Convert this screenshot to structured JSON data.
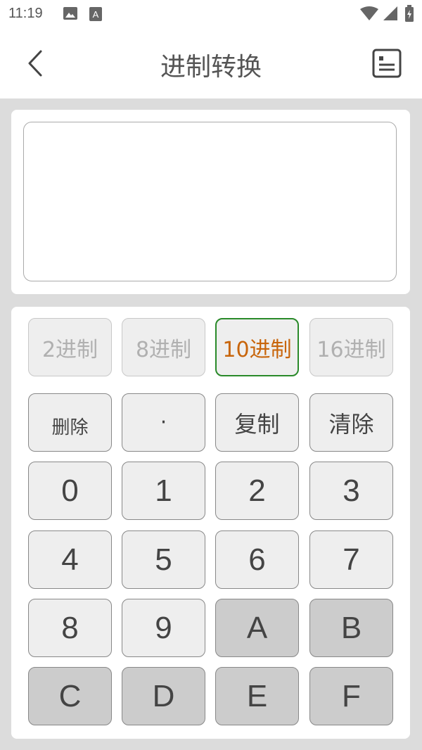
{
  "status_bar": {
    "time": "11:19"
  },
  "header": {
    "title": "进制转换"
  },
  "display": {
    "value": ""
  },
  "bases": [
    {
      "label": "2进制",
      "active": false
    },
    {
      "label": "8进制",
      "active": false
    },
    {
      "label": "10进制",
      "active": true
    },
    {
      "label": "16进制",
      "active": false
    }
  ],
  "functions": {
    "delete": "删除",
    "dot": "·",
    "copy": "复制",
    "clear": "清除"
  },
  "keys": [
    "0",
    "1",
    "2",
    "3",
    "4",
    "5",
    "6",
    "7",
    "8",
    "9",
    "A",
    "B",
    "C",
    "D",
    "E",
    "F"
  ],
  "colors": {
    "active_base_text": "#c8650b",
    "active_base_border": "#2a8a2a",
    "hex_key_bg": "#cccccc"
  }
}
